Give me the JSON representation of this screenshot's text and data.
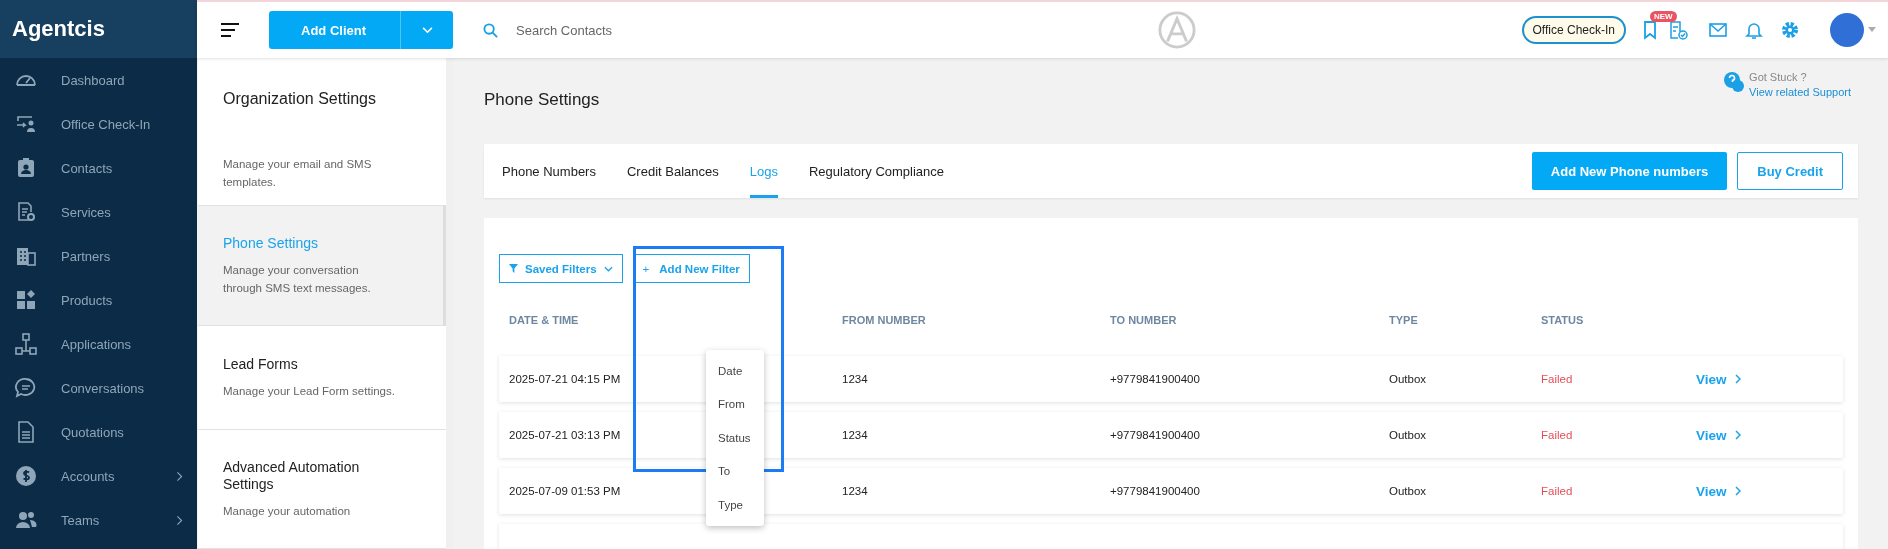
{
  "sidebar": {
    "brand": "Agentcis",
    "items": [
      {
        "label": "Dashboard",
        "has_submenu": false
      },
      {
        "label": "Office Check-In",
        "has_submenu": false
      },
      {
        "label": "Contacts",
        "has_submenu": false
      },
      {
        "label": "Services",
        "has_submenu": false
      },
      {
        "label": "Partners",
        "has_submenu": false
      },
      {
        "label": "Products",
        "has_submenu": false
      },
      {
        "label": "Applications",
        "has_submenu": false
      },
      {
        "label": "Conversations",
        "has_submenu": false
      },
      {
        "label": "Quotations",
        "has_submenu": false
      },
      {
        "label": "Accounts",
        "has_submenu": true
      },
      {
        "label": "Teams",
        "has_submenu": true
      }
    ]
  },
  "topbar": {
    "add_client": "Add Client",
    "search": {
      "placeholder": "Search Contacts"
    },
    "office_checkin": "Office Check-In",
    "new_badge": "NEW"
  },
  "settings_panel": {
    "title": "Organization Settings",
    "items": [
      {
        "description": "Manage your email and SMS templates.",
        "selected": false
      },
      {
        "title": "Phone Settings",
        "description": "Manage your conversation through SMS text messages.",
        "selected": true
      },
      {
        "title": "Lead Forms",
        "description": "Manage your Lead Form settings.",
        "selected": false
      },
      {
        "title": "Advanced Automation Settings",
        "description": "Manage your automation",
        "selected": false
      }
    ]
  },
  "page": {
    "title": "Phone Settings",
    "help": {
      "question": "Got Stuck ?",
      "link": "View related Support"
    }
  },
  "tabs": [
    {
      "label": "Phone Numbers",
      "selected": false
    },
    {
      "label": "Credit Balances",
      "selected": false
    },
    {
      "label": "Logs",
      "selected": true
    },
    {
      "label": "Regulatory Compliance",
      "selected": false
    }
  ],
  "actions": [
    {
      "label": "Add New Phone numbers",
      "kind": "primary"
    },
    {
      "label": "Buy Credit",
      "kind": "outline"
    }
  ],
  "filters": {
    "saved": "Saved Filters",
    "add": "Add New Filter",
    "plus": "+",
    "menu": [
      "Date",
      "From",
      "Status",
      "To",
      "Type"
    ]
  },
  "table": {
    "columns": [
      "DATE & TIME",
      "FROM NUMBER",
      "TO NUMBER",
      "TYPE",
      "STATUS"
    ],
    "rows": [
      {
        "date": "2025-07-21 04:15 PM",
        "from": "1234",
        "to": "+9779841900400",
        "type": "Outbox",
        "status": "Failed",
        "action": "View"
      },
      {
        "date": "2025-07-21 03:13 PM",
        "from": "1234",
        "to": "+9779841900400",
        "type": "Outbox",
        "status": "Failed",
        "action": "View"
      },
      {
        "date": "2025-07-09 01:53 PM",
        "from": "1234",
        "to": "+9779841900400",
        "type": "Outbox",
        "status": "Failed",
        "action": "View"
      }
    ]
  }
}
